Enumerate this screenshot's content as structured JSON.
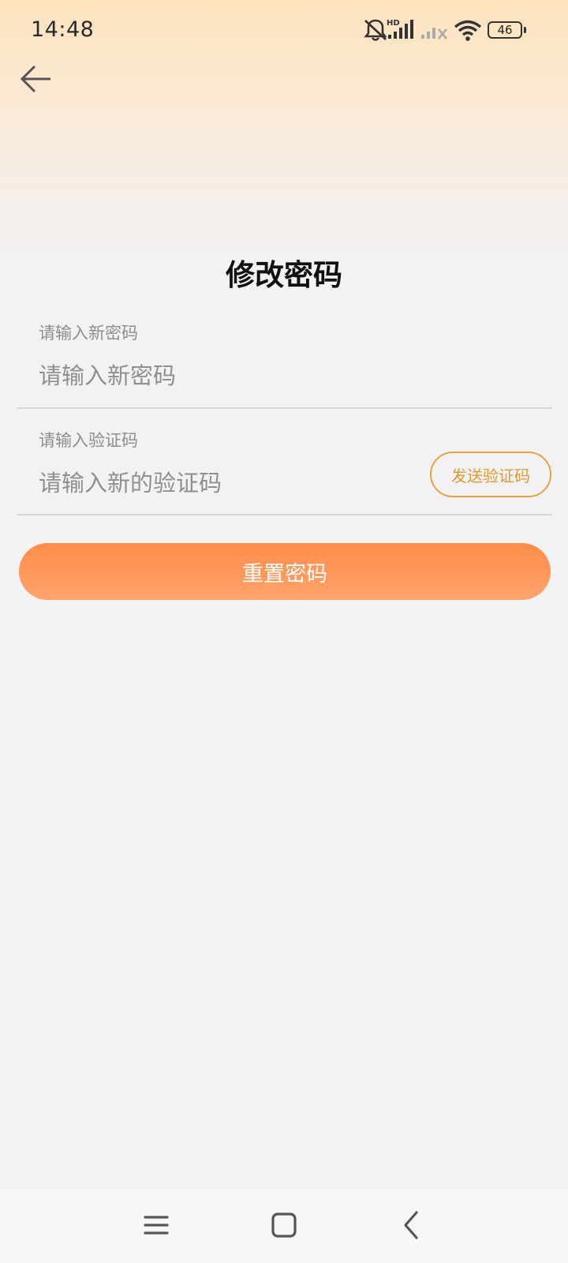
{
  "status_bar": {
    "time": "14:48",
    "battery": "46",
    "network_label": "HD",
    "icons": [
      "mute-icon",
      "signal-icon",
      "signal-no-service-icon",
      "wifi-icon",
      "battery-icon"
    ]
  },
  "header": {
    "back_icon": "arrow-left-icon"
  },
  "page": {
    "title": "修改密码"
  },
  "form": {
    "new_password": {
      "label": "请输入新密码",
      "placeholder": "请输入新密码",
      "value": ""
    },
    "verification_code": {
      "label": "请输入验证码",
      "placeholder": "请输入新的验证码",
      "value": "",
      "send_button": "发送验证码"
    },
    "submit_label": "重置密码"
  },
  "colors": {
    "accent_orange": "#ff8c48",
    "send_button_border": "#e8a23b",
    "header_gradient_top": "#fde3bd",
    "background": "#f2f2f4"
  },
  "nav_bar": {
    "icons": [
      "menu-icon",
      "home-icon",
      "back-icon"
    ]
  }
}
